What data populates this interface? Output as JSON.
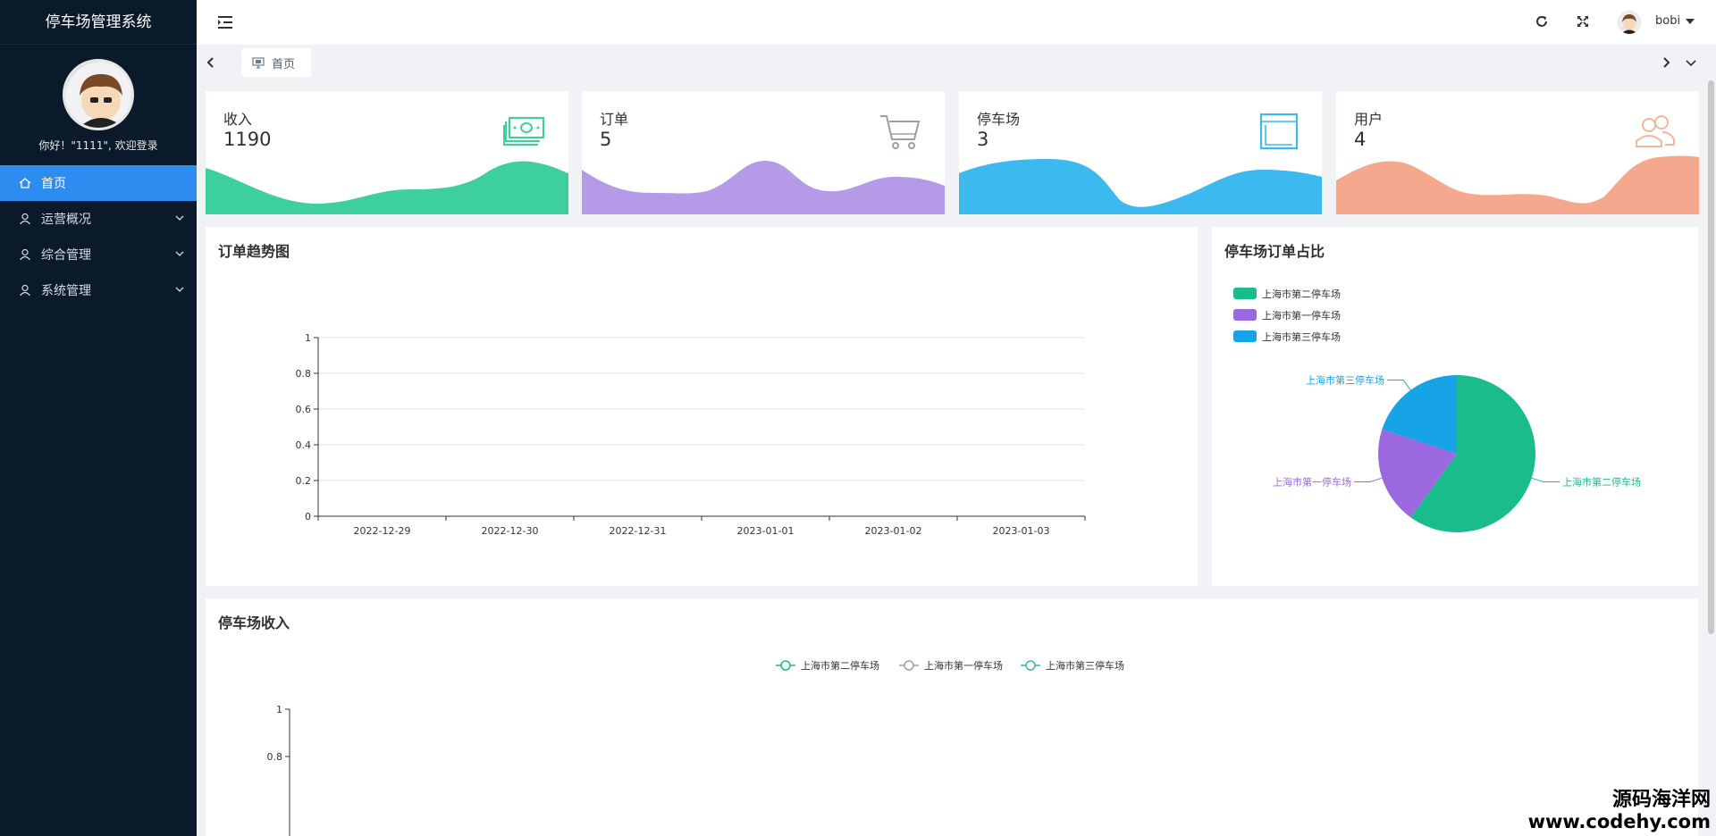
{
  "sidebar": {
    "brand": "停车场管理系统",
    "greeting": "你好！\"1111\", 欢迎登录",
    "items": [
      {
        "label": "首页",
        "active": true
      },
      {
        "label": "运营概况"
      },
      {
        "label": "综合管理"
      },
      {
        "label": "系统管理"
      }
    ]
  },
  "header": {
    "username": "bobi"
  },
  "tabs": [
    {
      "label": "首页"
    }
  ],
  "cards": [
    {
      "label": "收入",
      "value": "1190",
      "icon": "money-icon",
      "color": "#3ecf9e"
    },
    {
      "label": "订单",
      "value": "5",
      "icon": "cart-icon",
      "color": "#b59ae8"
    },
    {
      "label": "停车场",
      "value": "3",
      "icon": "window-icon",
      "color": "#3cb9ef"
    },
    {
      "label": "用户",
      "value": "4",
      "icon": "users-icon",
      "color": "#f5a88e"
    }
  ],
  "panels": {
    "order_trend": {
      "title": "订单趋势图"
    },
    "lot_share": {
      "title": "停车场订单占比"
    },
    "lot_income": {
      "title": "停车场收入"
    }
  },
  "chart_data": [
    {
      "type": "line",
      "x": [
        "2022-12-29",
        "2022-12-30",
        "2022-12-31",
        "2023-01-01",
        "2023-01-02",
        "2023-01-03"
      ],
      "yticks": [
        "1",
        "0.8",
        "0.6",
        "0.4",
        "0.2",
        "0"
      ],
      "ylim": [
        0,
        1
      ],
      "series": [],
      "grid": true
    },
    {
      "type": "pie",
      "legend": [
        "上海市第二停车场",
        "上海市第一停车场",
        "上海市第三停车场"
      ],
      "legend_position": "top-left",
      "slices": [
        {
          "label": "上海市第二停车场",
          "value": 3,
          "color": "#1abc8c"
        },
        {
          "label": "上海市第一停车场",
          "value": 1,
          "color": "#9b68e0"
        },
        {
          "label": "上海市第三停车场",
          "value": 1,
          "color": "#17a4e6"
        }
      ]
    },
    {
      "type": "line",
      "legend": [
        "上海市第二停车场",
        "上海市第一停车场",
        "上海市第三停车场"
      ],
      "legend_position": "top-center",
      "legend_colors": [
        "#1abc8c",
        "#9ba0a8",
        "#3fb9a0"
      ],
      "yticks": [
        "1",
        "0.8"
      ],
      "ylim": [
        0,
        1
      ],
      "series": []
    }
  ],
  "watermark": {
    "line1": "源码海洋网",
    "line2": "www.codehy.com"
  }
}
